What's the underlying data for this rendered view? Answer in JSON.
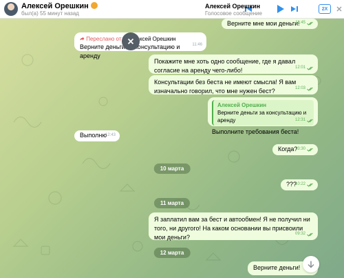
{
  "header": {
    "chat_name": "Алексей Орешкин",
    "status": "был(а) 55 минут назад",
    "player_name": "Алексей Орешкин",
    "player_subtitle": "Голосовое сообщение",
    "speed": "2X",
    "icons": [
      "avatar",
      "emoji",
      "prev-icon",
      "play-icon",
      "next-icon",
      "speed-button",
      "close-icon"
    ]
  },
  "messages": [
    {
      "dir": "out",
      "text": "Верните мне мои деньги!",
      "time": "11:45"
    },
    {
      "dir": "in",
      "forwarded_prefix": "Переслано от",
      "forwarded_from": "Алексей Орешкин",
      "text": "Верните деньги за консультацию и аренду",
      "time": "11:46"
    },
    {
      "dir": "out",
      "text": "Покажите мне хоть одно сообщение, где я давал согласие на аренду чего-либо!",
      "time": "12:01"
    },
    {
      "dir": "out",
      "text": "Консультации без беста не имеют смысла! Я вам изначально говорил, что мне нужен бест?",
      "time": "12:03"
    },
    {
      "dir": "out",
      "reply_name": "Алексей Орешкин",
      "reply_text": "Верните деньги за консультацию и аренду",
      "text": "Выполните требования беста!",
      "time": "12:31"
    },
    {
      "dir": "in",
      "text": "Выполню",
      "time": "12:43"
    },
    {
      "dir": "out",
      "text": "Когда?",
      "time": "13:30"
    },
    {
      "dir": "out",
      "text": "???",
      "time": "10:22"
    },
    {
      "dir": "out",
      "text": "Я заплатил вам за бест и автообмен! Я не получил ни того, ни другого! На каком основании вы присвоили мои деньги?",
      "time": "09:32"
    },
    {
      "dir": "out",
      "text": "Верните деньги!",
      "time": ""
    }
  ],
  "dates": [
    "10 марта",
    "11 марта",
    "12 марта"
  ],
  "colors": {
    "accent": "#3390ec",
    "out_bubble": "#effdde",
    "in_bubble": "#ffffff",
    "check": "#5fae5a",
    "forward": "#e05a5a"
  }
}
